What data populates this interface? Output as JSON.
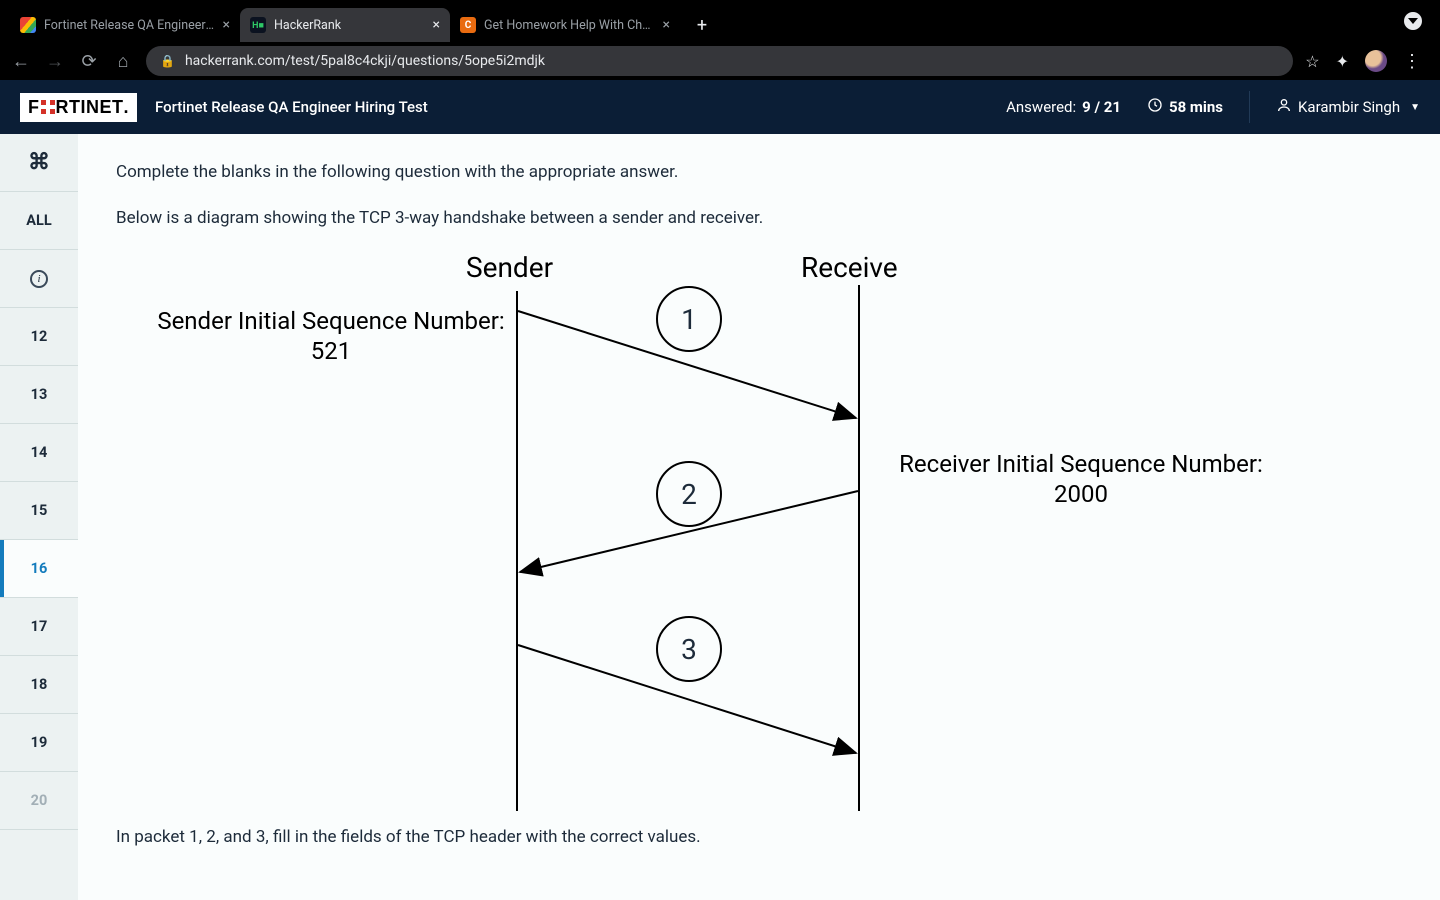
{
  "browser": {
    "tabs": [
      {
        "title": "Fortinet Release QA Engineer H",
        "favicon": "gmail"
      },
      {
        "title": "HackerRank",
        "favicon": "hackerrank",
        "active": true
      },
      {
        "title": "Get Homework Help With Cheg",
        "favicon": "chegg"
      }
    ],
    "url": "hackerrank.com/test/5pal8c4ckji/questions/5ope5i2mdjk"
  },
  "header": {
    "logo_text_left": "F",
    "logo_text_right": "RTINET",
    "test_title": "Fortinet Release QA Engineer Hiring Test",
    "answered_label": "Answered:",
    "answered_value": "9 / 21",
    "time_value": "58 mins",
    "user_name": "Karambir Singh"
  },
  "sidebar": {
    "all_label": "ALL",
    "items": [
      "12",
      "13",
      "14",
      "15",
      "16",
      "17",
      "18",
      "19",
      "20"
    ],
    "active": "16",
    "muted": [
      "20"
    ]
  },
  "question": {
    "intro": "Complete the blanks in the following question with the appropriate answer.",
    "desc": "Below is a diagram showing the TCP 3-way handshake between a sender and receiver.",
    "footer": "In packet 1, 2, and 3, fill in the fields of the TCP header with the correct values."
  },
  "diagram": {
    "sender_title": "Sender",
    "receiver_title": "Receive",
    "sender_isn_line1": "Sender Initial Sequence Number:",
    "sender_isn_line2": "521",
    "receiver_isn_line1": "Receiver Initial Sequence Number:",
    "receiver_isn_line2": "2000",
    "packet1": "1",
    "packet2": "2",
    "packet3": "3"
  }
}
